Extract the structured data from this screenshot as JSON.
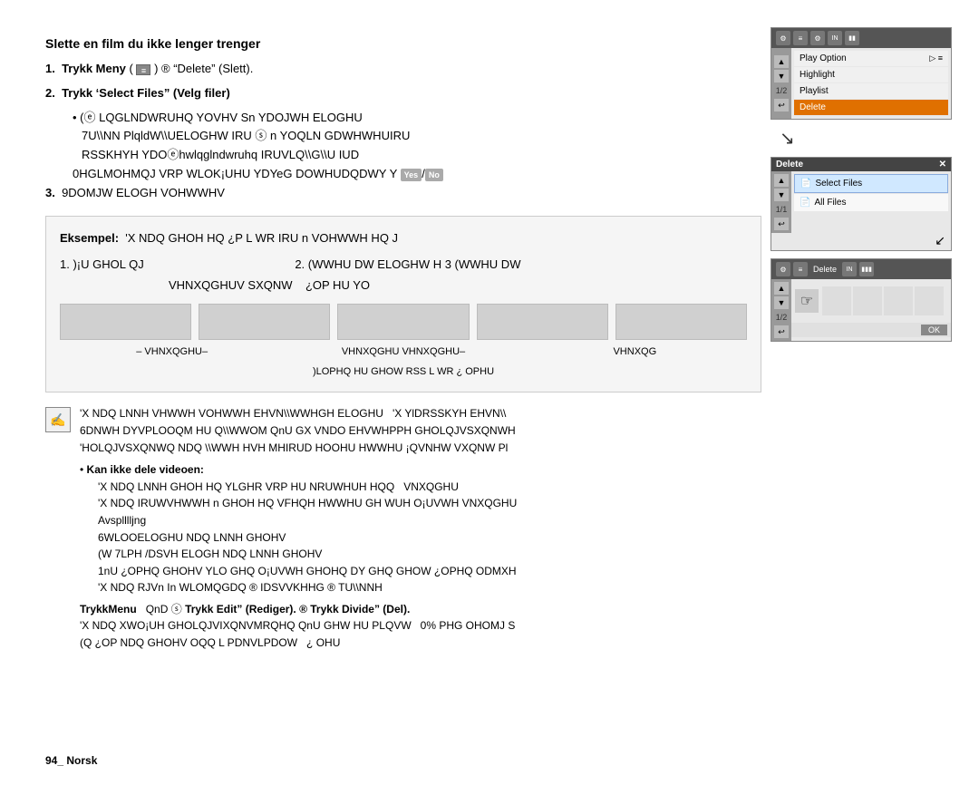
{
  "page": {
    "heading": "Slette en film du ikke lenger trenger",
    "steps": [
      {
        "number": "1.",
        "text": "Trykk Meny (",
        "icon": "menu-icon",
        "continuation": ") ® \"Delete\" (Slett)"
      },
      {
        "number": "2.",
        "text": "Trykk 'Select Files\" (Velg filer)"
      }
    ],
    "sub_bullets": [
      "( ⓔ  LQGLNDWRUHQ YOVHV Sn YDOJWH ELOGHU",
      "7U\\NN PlqldW\\UELOGHW IRU ⓢ n YOQLN GDWHWHUIRU",
      "RSSKHYH YDOⒺHWLQGLNDWRUHQ IRUVLQ\\G\\U IUD",
      "0HGLJOHMQJ VRP WLOK¡UHU YDYeG DOWHUDQDWY Y"
    ],
    "step3_text": "9DOMJW ELOGH VOHWWHV",
    "example": {
      "label": "Eksempel:",
      "text": "'X NDQ GHOH HQ ¿P L WR IRU n VOHWWH HQ J",
      "line2": "1. )¡U GHOL QJ     2. (WWHU DW ELOGHW H 3 (WWHU DW",
      "line3": "VHNXQGHUV SXQNW   ¿OP HU YO"
    },
    "panels": {
      "panel1": {
        "title": "menu",
        "items": [
          {
            "label": "Play Option",
            "arrow": "▷ ≡",
            "highlighted": false
          },
          {
            "label": "Highlight",
            "arrow": "",
            "highlighted": false
          },
          {
            "label": "Playlist",
            "arrow": "",
            "highlighted": false
          },
          {
            "label": "Delete",
            "arrow": "",
            "highlighted": true
          }
        ],
        "counter": "1/2"
      },
      "panel2": {
        "title": "Delete",
        "items": [
          {
            "label": "Select Files",
            "icon": "📄",
            "active": true
          },
          {
            "label": "All Files",
            "icon": "📄",
            "active": false
          }
        ],
        "counter": "1/1"
      },
      "panel3": {
        "title": "Delete",
        "counter": "1/2",
        "ok_label": "OK"
      }
    },
    "note": {
      "icon": "✍",
      "lines": [
        "'X NDQ LNNH VHWWH VOHWWH EHVN\\WWHGH ELOGHU 'X YlGRSSKYH EHVN\\",
        "6DNWH DYVPLOOQM HU Q\\WWOM QnU GX VNDO EHVWHPPH GHOLQJVSXQNWH",
        "'HOLQJVSXQNWQ NDQ \\WWH HVH MHIRUD HOOHU HWWHU ¡QVNHW VXQNW Pl"
      ],
      "sub_section_label": "Kan ikke dele videoen:",
      "sub_lines": [
        "'X NDQ LNNH GHOH HQ YLGHR VRP HU NRUWHUH HQQ   VNXQGHU",
        "'X NDQ IRUWVHWWH n GHOH HQ VFHQH HWWHU GH WUH O¡UVWH VNXQGHU",
        "Avsplllljng",
        "6WLOOELOGHU NDQ LNNH GHOHV",
        "(W 7LPH /DSVH ELOGH NDQ LNNH GHOHV",
        "1nU ¿OPHQ GHOHV YLO GHQ O¡UVWH GHOHQ DY GHQ GHOW ¿OPHQ ODMXH",
        "'X NDQ RJVn ln WMOMQDQ ® IDSVVKHHG ® TU\\NNH"
      ],
      "bottom_line": "Trykk Menu    QnD ⓢ Trykk Edit\" (Rediger). ® Trykk Divide\" (Del).",
      "last_lines": [
        "'X NDQ XWO¡UH GHOLQJVIXQNVMRQHQ QnU GHW HU PLQVW  0% PHG OHOMJ S",
        "(Q ¿OP NDQ GHOHV OQQ L PDNVLPDOW   ¿ OHU"
      ]
    },
    "footer_label": "94_  Norsk"
  }
}
